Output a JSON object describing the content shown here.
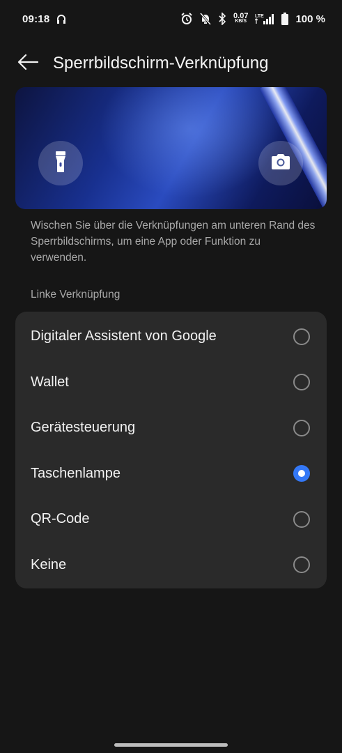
{
  "status_bar": {
    "time": "09:18",
    "net_speed_value": "0.07",
    "net_speed_unit": "KB/S",
    "network_type": "LTE",
    "battery": "100 %"
  },
  "header": {
    "title": "Sperrbildschirm-Verknüpfung"
  },
  "preview": {
    "left_icon": "flashlight-icon",
    "right_icon": "camera-icon"
  },
  "description": "Wischen Sie über die Verknüpfungen am unteren Rand des Sperrbildschirms, um eine App oder Funktion zu verwenden.",
  "section_label": "Linke Verknüpfung",
  "options": [
    {
      "label": "Digitaler Assistent von Google",
      "selected": false
    },
    {
      "label": "Wallet",
      "selected": false
    },
    {
      "label": "Gerätesteuerung",
      "selected": false
    },
    {
      "label": "Taschenlampe",
      "selected": true
    },
    {
      "label": "QR-Code",
      "selected": false
    },
    {
      "label": "Keine",
      "selected": false
    }
  ],
  "colors": {
    "accent": "#3478f6",
    "background": "#161616",
    "card": "#2a2a2a"
  }
}
